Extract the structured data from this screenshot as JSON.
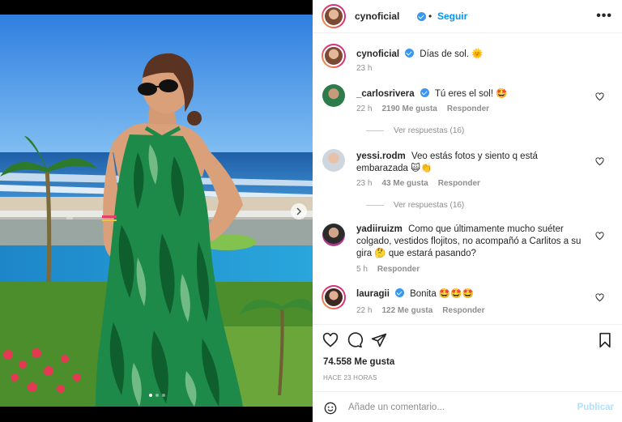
{
  "post": {
    "author": "cynoficial",
    "follow_label": "Seguir",
    "caption": "Días de sol. 🌞",
    "caption_time": "23 h",
    "likes": "74.558 Me gusta",
    "time_ago": "HACE 23 HORAS"
  },
  "comments": [
    {
      "user": "_carlosrivera",
      "verified": true,
      "text": "Tú eres el sol! 🤩",
      "time": "22 h",
      "likes": "2190 Me gusta",
      "reply": "Responder",
      "view_replies": "Ver respuestas (16)"
    },
    {
      "user": "yessi.rodm",
      "verified": false,
      "text": "Veo estás fotos y siento q está embarazada 🙀👏",
      "time": "23 h",
      "likes": "43 Me gusta",
      "reply": "Responder",
      "view_replies": "Ver respuestas (16)"
    },
    {
      "user": "yadiiruizm",
      "verified": false,
      "text": "Como que últimamente mucho suéter colgado, vestidos flojitos, no acompañó a Carlitos a su gira 🤔 que estará pasando?",
      "time": "5 h",
      "reply": "Responder"
    },
    {
      "user": "lauragii",
      "verified": true,
      "text": "Bonita 🤩🤩🤩",
      "time": "22 h",
      "likes": "122 Me gusta",
      "reply": "Responder"
    }
  ],
  "composer": {
    "placeholder": "Añade un comentario...",
    "publish_label": "Publicar"
  },
  "colors": {
    "link_blue": "#0095f6",
    "publish_disabled": "#b2dffc",
    "verified_blue": "#3897f0",
    "dress_green": "#1e8a4a"
  },
  "icons": [
    "more-options-icon",
    "heart-icon",
    "comment-icon",
    "share-icon",
    "bookmark-icon",
    "emoji-icon",
    "next-arrow-icon"
  ],
  "carousel": {
    "slides": 3,
    "current": 1
  }
}
